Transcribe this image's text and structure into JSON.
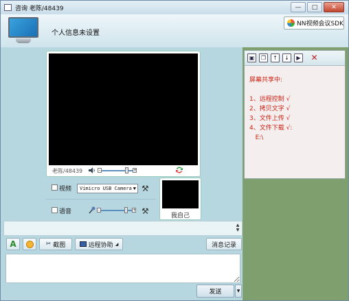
{
  "window": {
    "title": "咨询 老陈/48439",
    "controls": [
      "minimize",
      "maximize",
      "close"
    ]
  },
  "header": {
    "profile_text": "个人信息未设置",
    "sdk_button": "NN视频会议SDK"
  },
  "video": {
    "remote_name": "老陈/48439",
    "volume_level": 0.85,
    "self_label": "我自己"
  },
  "devices": {
    "video_label": "视频",
    "video_checked": false,
    "camera_select": "Vimicro USB Camera",
    "audio_label": "语音",
    "audio_checked": false,
    "mic_level": 0.85
  },
  "chat_toolbar": {
    "font_label": "A",
    "screenshot_label": "截图",
    "remote_assist_label": "远程协助",
    "history_label": "消息记录"
  },
  "chat": {
    "input_value": "",
    "send_label": "发送"
  },
  "share_panel": {
    "text": "屏幕共享中:\n\n1、远程控制 √\n2、拷贝文字 √\n3、文件上传 √\n4、文件下载 √:\n   E:\\"
  },
  "colors": {
    "accent_red": "#cc2211",
    "panel_green": "#7f9f6f",
    "main_bg": "#b7d7e0"
  },
  "icons": {
    "titlebar": "app-icon",
    "header": "monitor-icon",
    "speaker": "speaker-icon",
    "switch": "switch-camera-icon",
    "microphone": "microphone-icon",
    "settings": "tool-icon",
    "emoji": "emoji-icon",
    "scissors": "scissors-icon",
    "remote": "remote-assist-icon"
  }
}
